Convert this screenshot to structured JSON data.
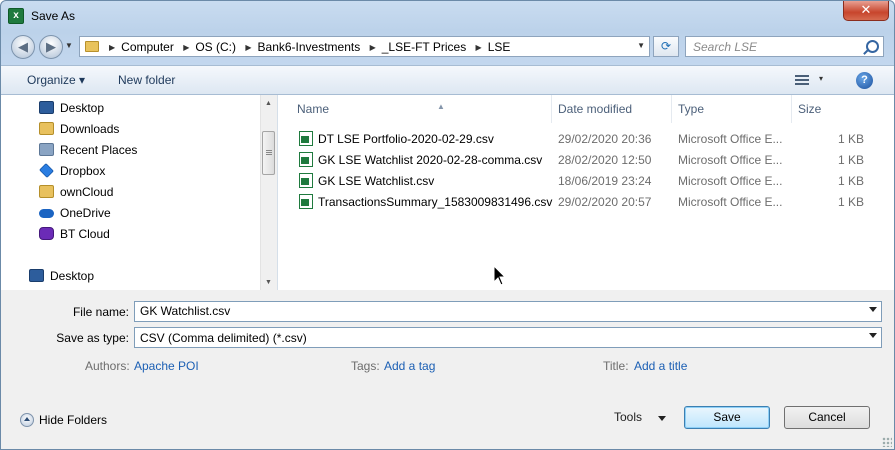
{
  "window": {
    "title": "Save As",
    "close_glyph": "✕"
  },
  "nav": {
    "back_glyph": "◀",
    "forward_glyph": "▶",
    "breadcrumbs": [
      "Computer",
      "OS (C:)",
      "Bank6-Investments",
      "_LSE-FT Prices",
      "LSE"
    ],
    "refresh_glyph": "⟳",
    "search_placeholder": "Search LSE"
  },
  "toolbar": {
    "organize_label": "Organize ▾",
    "new_folder_label": "New folder",
    "views_drop": "▾",
    "help_glyph": "?"
  },
  "sidebar": {
    "items": [
      {
        "label": "Desktop",
        "icon": "desktop-icon"
      },
      {
        "label": "Downloads",
        "icon": "downloads-icon"
      },
      {
        "label": "Recent Places",
        "icon": "recent-places-icon"
      },
      {
        "label": "Dropbox",
        "icon": "dropbox-icon"
      },
      {
        "label": "ownCloud",
        "icon": "owncloud-icon"
      },
      {
        "label": "OneDrive",
        "icon": "onedrive-icon"
      },
      {
        "label": "BT Cloud",
        "icon": "bt-cloud-icon"
      }
    ],
    "root": {
      "label": "Desktop",
      "icon": "desktop-icon"
    }
  },
  "columns": {
    "name": "Name",
    "date": "Date modified",
    "type": "Type",
    "size": "Size"
  },
  "files": [
    {
      "name": "DT LSE Portfolio-2020-02-29.csv",
      "date": "29/02/2020 20:36",
      "type": "Microsoft Office E...",
      "size": "1 KB"
    },
    {
      "name": "GK LSE Watchlist 2020-02-28-comma.csv",
      "date": "28/02/2020 12:50",
      "type": "Microsoft Office E...",
      "size": "1 KB"
    },
    {
      "name": "GK LSE Watchlist.csv",
      "date": "18/06/2019 23:24",
      "type": "Microsoft Office E...",
      "size": "1 KB"
    },
    {
      "name": "TransactionsSummary_1583009831496.csv",
      "date": "29/02/2020 20:57",
      "type": "Microsoft Office E...",
      "size": "1 KB"
    }
  ],
  "form": {
    "file_name_label": "File name:",
    "file_name_value": "GK Watchlist.csv",
    "save_type_label": "Save as type:",
    "save_type_value": "CSV (Comma delimited) (*.csv)",
    "authors_label": "Authors:",
    "authors_value": "Apache POI",
    "tags_label": "Tags:",
    "tags_value": "Add a tag",
    "title_label": "Title:",
    "title_value": "Add a title"
  },
  "footer": {
    "hide_folders_label": "Hide Folders",
    "tools_label": "Tools",
    "save_label": "Save",
    "cancel_label": "Cancel"
  },
  "colors": {
    "accent": "#1b5fb4",
    "title_bg": "#c9dcf0",
    "close": "#c7452c"
  }
}
